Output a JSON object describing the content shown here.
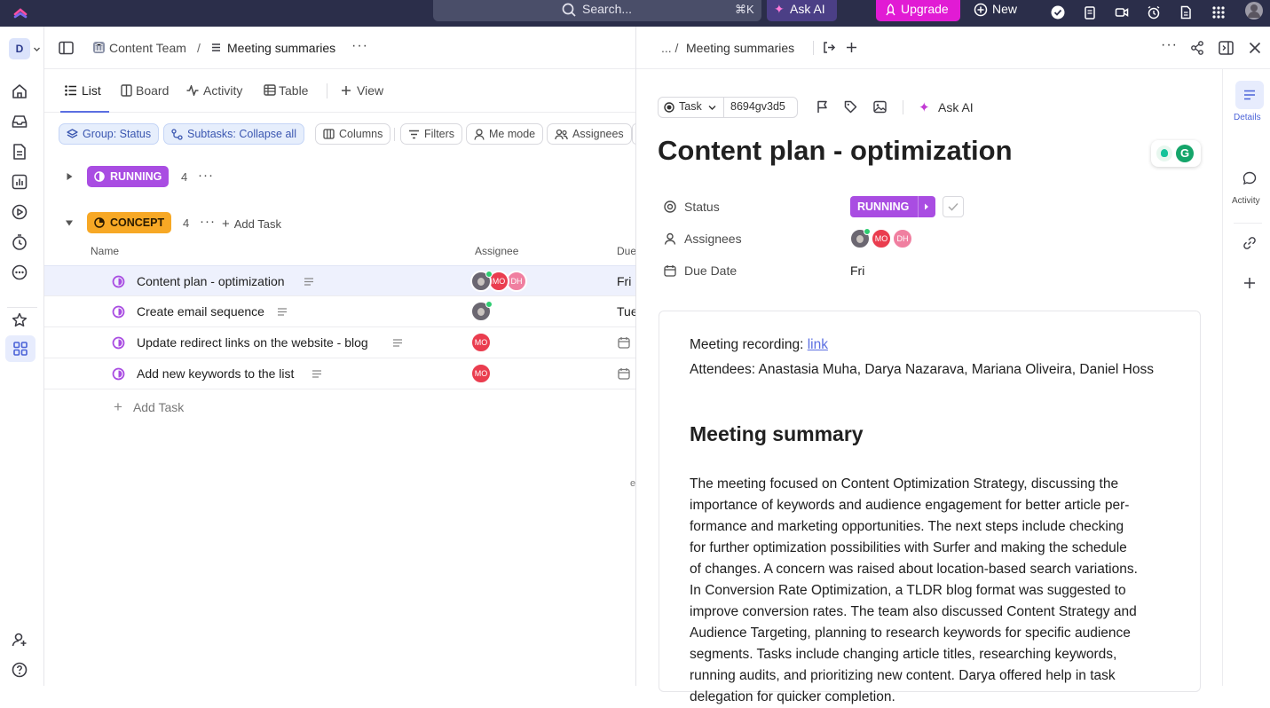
{
  "topbar": {
    "search_placeholder": "Search...",
    "search_shortcut": "⌘K",
    "ask_ai": "Ask AI",
    "upgrade": "Upgrade",
    "new": "New"
  },
  "workspace": {
    "initial": "D"
  },
  "breadcrumb": {
    "space": "Content Team",
    "separator": "/",
    "page": "Meeting summaries"
  },
  "views": {
    "tabs": [
      "List",
      "Board",
      "Activity",
      "Table"
    ],
    "add_view": "View",
    "active": "List"
  },
  "toolbar": {
    "group": "Group: Status",
    "subtasks": "Subtasks: Collapse all",
    "columns": "Columns",
    "filters": "Filters",
    "me_mode": "Me mode",
    "assignees": "Assignees"
  },
  "groups": {
    "running": {
      "label": "RUNNING",
      "count": "4",
      "color": "#a94de2"
    },
    "concept": {
      "label": "CONCEPT",
      "count": "4",
      "color": "#f7a825",
      "add_task": "Add Task"
    }
  },
  "table": {
    "columns": {
      "name": "Name",
      "assignee": "Assignee",
      "due": "Due"
    },
    "rows": [
      {
        "title": "Content plan - optimization",
        "due": "Fri",
        "assignees": [
          "photo",
          "MO",
          "DH"
        ]
      },
      {
        "title": "Create email sequence",
        "due": "Tue",
        "assignees": [
          "photo"
        ]
      },
      {
        "title": "Update redirect links on the website - blog",
        "due": "",
        "assignees": [
          "MO"
        ]
      },
      {
        "title": "Add new keywords to the list",
        "due": "",
        "assignees": [
          "MO"
        ]
      }
    ],
    "add_task": "Add Task",
    "truncated_char": "e"
  },
  "panel": {
    "breadcrumb_prefix": "... /",
    "breadcrumb_page": "Meeting summaries",
    "task_type": "Task",
    "task_id": "8694gv3d5",
    "ask_ai": "Ask AI",
    "title": "Content plan - optimization",
    "fields": {
      "status_label": "Status",
      "status_value": "RUNNING",
      "assignees_label": "Assignees",
      "assignee_initials": [
        "MO",
        "DH"
      ],
      "due_label": "Due Date",
      "due_value": "Fri"
    },
    "side_tabs": {
      "details": "Details",
      "activity": "Activity"
    },
    "content": {
      "recording_label": "Meeting recording: ",
      "recording_link": "link",
      "attendees": "Attendees: Anastasia Muha, Darya Nazarava, Mariana Oliveira, Daniel Hoss",
      "heading": "Meeting summary",
      "summary_lines": [
        "The meeting focused on Content Optimization Strategy, discussing the",
        "importance of keywords and audience engagement for better article per-",
        "formance and marketing opportunities. The next steps include checking",
        "for further optimization possibilities with Surfer and making the schedule",
        "of changes. A concern was raised about location-based search variations.",
        "In Conversion Rate Optimization, a TLDR blog format was suggested to",
        "improve conversion rates. The team also discussed Content Strategy and",
        "Audience Targeting, planning to research keywords for specific audience",
        "segments. Tasks include changing article titles, researching keywords,",
        "running audits, and prioritizing new content. Darya offered help in task",
        "delegation for quicker completion."
      ]
    }
  },
  "colors": {
    "topbar": "#2b2e4a",
    "accent_blue": "#5b6ee1",
    "running": "#a94de2",
    "concept": "#f7a825",
    "avatar_mo": "#ea3d4f",
    "avatar_dh": "#f07fa0",
    "upgrade": "#e11bd4"
  }
}
